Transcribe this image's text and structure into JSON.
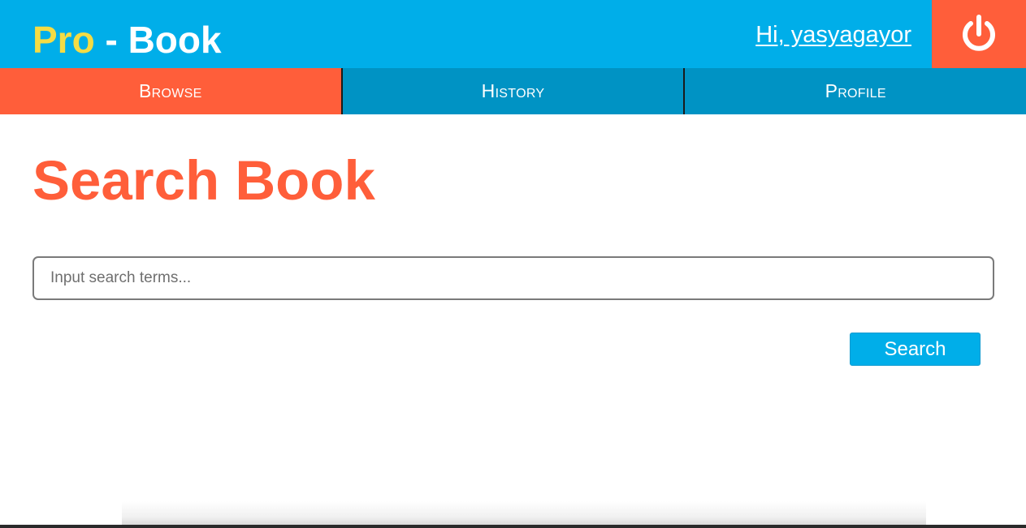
{
  "app": {
    "title_pro": "Pro",
    "title_rest": " - Book"
  },
  "header": {
    "greeting": "Hi, yasyagayor",
    "logout_icon": "power-icon"
  },
  "nav": {
    "tabs": [
      {
        "label": "Browse",
        "active": true
      },
      {
        "label": "History",
        "active": false
      },
      {
        "label": "Profile",
        "active": false
      }
    ]
  },
  "main": {
    "title": "Search Book",
    "search": {
      "value": "",
      "placeholder": "Input search terms..."
    },
    "search_button_label": "Search"
  },
  "colors": {
    "header_blue": "#00aee9",
    "nav_blue": "#0093c4",
    "accent_orange": "#ff5e3a",
    "logo_yellow": "#f5dc44"
  }
}
